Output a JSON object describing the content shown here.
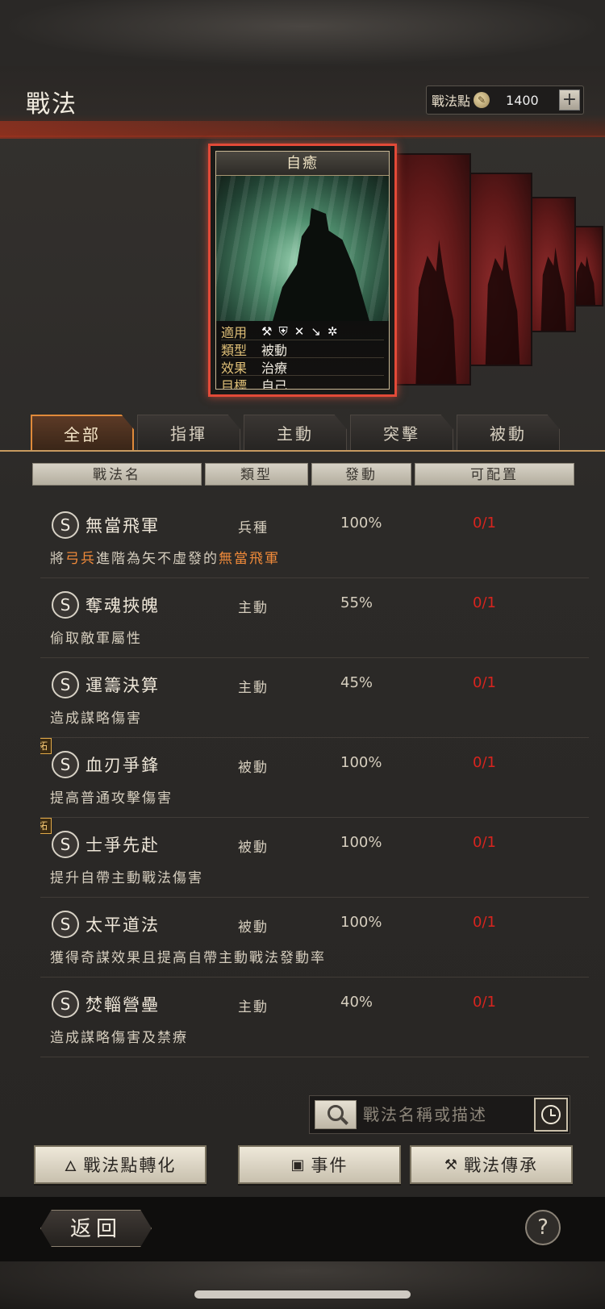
{
  "header": {
    "title": "戰法",
    "points_label": "戰法點",
    "points_value": "1400",
    "plus_label": "+"
  },
  "card": {
    "name": "自癒",
    "stats": [
      {
        "key": "適用",
        "value": ""
      },
      {
        "key": "類型",
        "value": "被動"
      },
      {
        "key": "效果",
        "value": "治療"
      },
      {
        "key": "目標",
        "value": "自己"
      }
    ]
  },
  "tabs": [
    "全部",
    "指揮",
    "主動",
    "突擊",
    "被動"
  ],
  "active_tab": "全部",
  "columns": [
    "戰法名",
    "類型",
    "發動",
    "可配置"
  ],
  "rows": [
    {
      "badge": "S",
      "tag": "",
      "name": "無當飛軍",
      "type": "兵種",
      "rate": "100%",
      "config": "0/1",
      "desc_a": "將",
      "desc_hl1": "弓兵",
      "desc_b": "進階為矢不虛發的",
      "desc_hl2": "無當飛軍",
      "desc_c": ""
    },
    {
      "badge": "S",
      "tag": "",
      "name": "奪魂挾魄",
      "type": "主動",
      "rate": "55%",
      "config": "0/1",
      "desc_a": "偷取敵軍屬性",
      "desc_hl1": "",
      "desc_b": "",
      "desc_hl2": "",
      "desc_c": ""
    },
    {
      "badge": "S",
      "tag": "",
      "name": "運籌決算",
      "type": "主動",
      "rate": "45%",
      "config": "0/1",
      "desc_a": "造成謀略傷害",
      "desc_hl1": "",
      "desc_b": "",
      "desc_hl2": "",
      "desc_c": ""
    },
    {
      "badge": "S",
      "tag": "拓",
      "name": "血刃爭鋒",
      "type": "被動",
      "rate": "100%",
      "config": "0/1",
      "desc_a": "提高普通攻擊傷害",
      "desc_hl1": "",
      "desc_b": "",
      "desc_hl2": "",
      "desc_c": ""
    },
    {
      "badge": "S",
      "tag": "拓",
      "name": "士爭先赴",
      "type": "被動",
      "rate": "100%",
      "config": "0/1",
      "desc_a": "提升自帶主動戰法傷害",
      "desc_hl1": "",
      "desc_b": "",
      "desc_hl2": "",
      "desc_c": ""
    },
    {
      "badge": "S",
      "tag": "",
      "name": "太平道法",
      "type": "被動",
      "rate": "100%",
      "config": "0/1",
      "desc_a": "獲得奇謀效果且提高自帶主動戰法發動率",
      "desc_hl1": "",
      "desc_b": "",
      "desc_hl2": "",
      "desc_c": ""
    },
    {
      "badge": "S",
      "tag": "",
      "name": "焚輜營壘",
      "type": "主動",
      "rate": "40%",
      "config": "0/1",
      "desc_a": "造成謀略傷害及禁療",
      "desc_hl1": "",
      "desc_b": "",
      "desc_hl2": "",
      "desc_c": ""
    }
  ],
  "search": {
    "placeholder": "戰法名稱或描述"
  },
  "buttons": {
    "convert": "戰法點轉化",
    "event": "事件",
    "inherit": "戰法傳承",
    "back": "返回",
    "help": "?"
  },
  "colors": {
    "accent": "#e08a3a",
    "config_red": "#d8241e",
    "highlight": "#f08a3a"
  },
  "icons": [
    "coin-icon",
    "axe-icon",
    "shield-icon",
    "crossbow-icon",
    "spear-icon",
    "wheel-icon",
    "search-icon",
    "clock-icon",
    "flame-icon",
    "event-icon",
    "hammer-icon",
    "help-icon"
  ]
}
